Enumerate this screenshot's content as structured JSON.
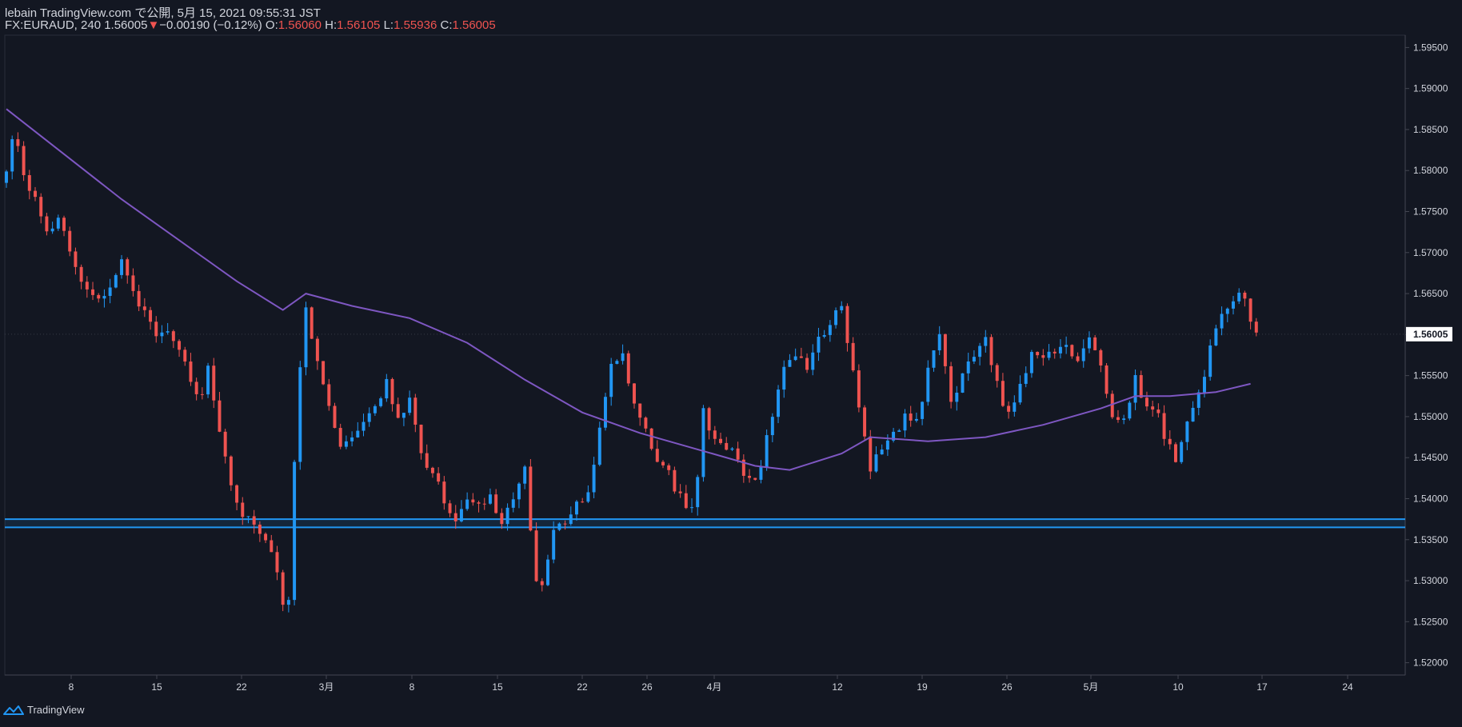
{
  "header": {
    "published": "lebain TradingView.com で公開, 5月 15, 2021 09:55:31 JST",
    "symbol_info": "FX:EURAUD, 240 1.56005",
    "change_arrow": "▼",
    "change": "−0.00190 (−0.12%)",
    "o_label": "O:",
    "o_value": "1.56060",
    "h_label": "H:",
    "h_value": "1.56105",
    "l_label": "L:",
    "l_value": "1.55936",
    "c_label": "C:",
    "c_value": "1.56005"
  },
  "footer": {
    "brand": "TradingView"
  },
  "colors": {
    "background": "#131722",
    "up": "#2196f3",
    "down": "#ef5350",
    "ma": "#7e57c2",
    "support": "#2196f3",
    "axis_text": "#d1d4dc",
    "last_price_tag": "#ffffff"
  },
  "chart_data": {
    "type": "candlestick",
    "symbol": "FX:EURAUD",
    "timeframe": "240",
    "ylim": [
      1.5185,
      1.5965
    ],
    "y_ticks": [
      "1.59500",
      "1.59000",
      "1.58500",
      "1.58000",
      "1.57500",
      "1.57000",
      "1.56500",
      "1.56000",
      "1.55500",
      "1.55000",
      "1.54500",
      "1.54000",
      "1.53500",
      "1.53000",
      "1.52500",
      "1.52000"
    ],
    "x_ticks": [
      "8",
      "15",
      "22",
      "3月",
      "8",
      "15",
      "22",
      "26",
      "4月",
      "12",
      "19",
      "26",
      "5月",
      "10",
      "17",
      "24"
    ],
    "last_price": "1.56005",
    "support_band": [
      1.5365,
      1.5375
    ],
    "price_path": [
      [
        0,
        1.5795
      ],
      [
        1,
        1.5845
      ],
      [
        3,
        1.58
      ],
      [
        5,
        1.576
      ],
      [
        7,
        1.572
      ],
      [
        9,
        1.574
      ],
      [
        11,
        1.57
      ],
      [
        13,
        1.567
      ],
      [
        16,
        1.564
      ],
      [
        18,
        1.566
      ],
      [
        20,
        1.569
      ],
      [
        22,
        1.565
      ],
      [
        24,
        1.563
      ],
      [
        26,
        1.56
      ],
      [
        28,
        1.561
      ],
      [
        30,
        1.558
      ],
      [
        32,
        1.554
      ],
      [
        34,
        1.552
      ],
      [
        35,
        1.5565
      ],
      [
        37,
        1.548
      ],
      [
        39,
        1.542
      ],
      [
        41,
        1.538
      ],
      [
        43,
        1.5375
      ],
      [
        45,
        1.5355
      ],
      [
        47,
        1.5305
      ],
      [
        48,
        1.5275
      ],
      [
        49,
        1.527
      ],
      [
        50,
        1.545
      ],
      [
        51,
        1.556
      ],
      [
        52,
        1.564
      ],
      [
        53,
        1.56
      ],
      [
        54,
        1.556
      ],
      [
        56,
        1.552
      ],
      [
        58,
        1.546
      ],
      [
        60,
        1.548
      ],
      [
        62,
        1.55
      ],
      [
        64,
        1.552
      ],
      [
        66,
        1.554
      ],
      [
        68,
        1.55
      ],
      [
        70,
        1.552
      ],
      [
        72,
        1.546
      ],
      [
        74,
        1.543
      ],
      [
        76,
        1.54
      ],
      [
        78,
        1.538
      ],
      [
        80,
        1.54
      ],
      [
        82,
        1.539
      ],
      [
        84,
        1.541
      ],
      [
        86,
        1.537
      ],
      [
        88,
        1.54
      ],
      [
        90,
        1.544
      ],
      [
        91,
        1.536
      ],
      [
        92,
        1.53
      ],
      [
        93,
        1.529
      ],
      [
        95,
        1.536
      ],
      [
        97,
        1.537
      ],
      [
        99,
        1.54
      ],
      [
        101,
        1.5405
      ],
      [
        103,
        1.548
      ],
      [
        105,
        1.556
      ],
      [
        107,
        1.557
      ],
      [
        109,
        1.552
      ],
      [
        111,
        1.548
      ],
      [
        113,
        1.545
      ],
      [
        115,
        1.543
      ],
      [
        117,
        1.54
      ],
      [
        119,
        1.539
      ],
      [
        120,
        1.542
      ],
      [
        121,
        1.551
      ],
      [
        123,
        1.547
      ],
      [
        125,
        1.546
      ],
      [
        127,
        1.545
      ],
      [
        129,
        1.542
      ],
      [
        131,
        1.544
      ],
      [
        133,
        1.55
      ],
      [
        135,
        1.556
      ],
      [
        137,
        1.558
      ],
      [
        139,
        1.556
      ],
      [
        141,
        1.56
      ],
      [
        143,
        1.561
      ],
      [
        145,
        1.564
      ],
      [
        146,
        1.559
      ],
      [
        147,
        1.555
      ],
      [
        149,
        1.548
      ],
      [
        150,
        1.544
      ],
      [
        152,
        1.546
      ],
      [
        154,
        1.548
      ],
      [
        156,
        1.55
      ],
      [
        158,
        1.549
      ],
      [
        160,
        1.556
      ],
      [
        162,
        1.56
      ],
      [
        164,
        1.552
      ],
      [
        166,
        1.555
      ],
      [
        168,
        1.558
      ],
      [
        170,
        1.56
      ],
      [
        172,
        1.554
      ],
      [
        174,
        1.55
      ],
      [
        176,
        1.554
      ],
      [
        178,
        1.558
      ],
      [
        180,
        1.557
      ],
      [
        182,
        1.558
      ],
      [
        184,
        1.559
      ],
      [
        186,
        1.556
      ],
      [
        188,
        1.56
      ],
      [
        190,
        1.556
      ],
      [
        192,
        1.55
      ],
      [
        194,
        1.549
      ],
      [
        196,
        1.555
      ],
      [
        198,
        1.551
      ],
      [
        200,
        1.55
      ],
      [
        202,
        1.546
      ],
      [
        203,
        1.544
      ],
      [
        205,
        1.55
      ],
      [
        207,
        1.553
      ],
      [
        209,
        1.558
      ],
      [
        211,
        1.563
      ],
      [
        213,
        1.564
      ],
      [
        215,
        1.565
      ],
      [
        216,
        1.562
      ],
      [
        217,
        1.56
      ]
    ],
    "ma_points": [
      [
        0,
        1.5875
      ],
      [
        10,
        1.582
      ],
      [
        20,
        1.5765
      ],
      [
        30,
        1.5715
      ],
      [
        40,
        1.5665
      ],
      [
        48,
        1.563
      ],
      [
        52,
        1.565
      ],
      [
        60,
        1.5635
      ],
      [
        70,
        1.562
      ],
      [
        80,
        1.559
      ],
      [
        90,
        1.5545
      ],
      [
        100,
        1.5505
      ],
      [
        110,
        1.548
      ],
      [
        120,
        1.546
      ],
      [
        130,
        1.544
      ],
      [
        136,
        1.5435
      ],
      [
        145,
        1.5455
      ],
      [
        150,
        1.5475
      ],
      [
        160,
        1.547
      ],
      [
        170,
        1.5475
      ],
      [
        180,
        1.549
      ],
      [
        190,
        1.551
      ],
      [
        196,
        1.5525
      ],
      [
        202,
        1.5525
      ],
      [
        210,
        1.553
      ],
      [
        216,
        1.554
      ]
    ]
  }
}
